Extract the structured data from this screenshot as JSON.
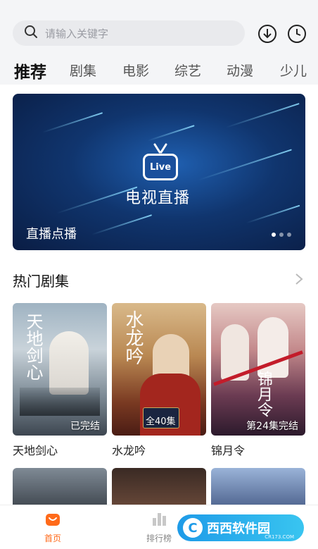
{
  "search": {
    "placeholder": "请输入关键字"
  },
  "tabs": [
    "推荐",
    "剧集",
    "电影",
    "综艺",
    "动漫",
    "少儿"
  ],
  "banner": {
    "badge": "Live",
    "title": "电视直播",
    "caption": "直播点播",
    "page_count": 3,
    "active_page": 1
  },
  "section": {
    "title": "热门剧集"
  },
  "dramas": [
    {
      "title": "天地剑心",
      "badge": "已完结",
      "art": "天地剑心"
    },
    {
      "title": "水龙吟",
      "badge": "全40集",
      "art": "水龙吟"
    },
    {
      "title": "锦月令",
      "badge": "第24集完结",
      "art": "锦月令"
    }
  ],
  "nav": {
    "home": "首页",
    "rank": "排行榜"
  },
  "watermark": {
    "text": "西西软件园",
    "sub": "CR173.COM"
  },
  "colors": {
    "accent": "#ff6a1a"
  }
}
